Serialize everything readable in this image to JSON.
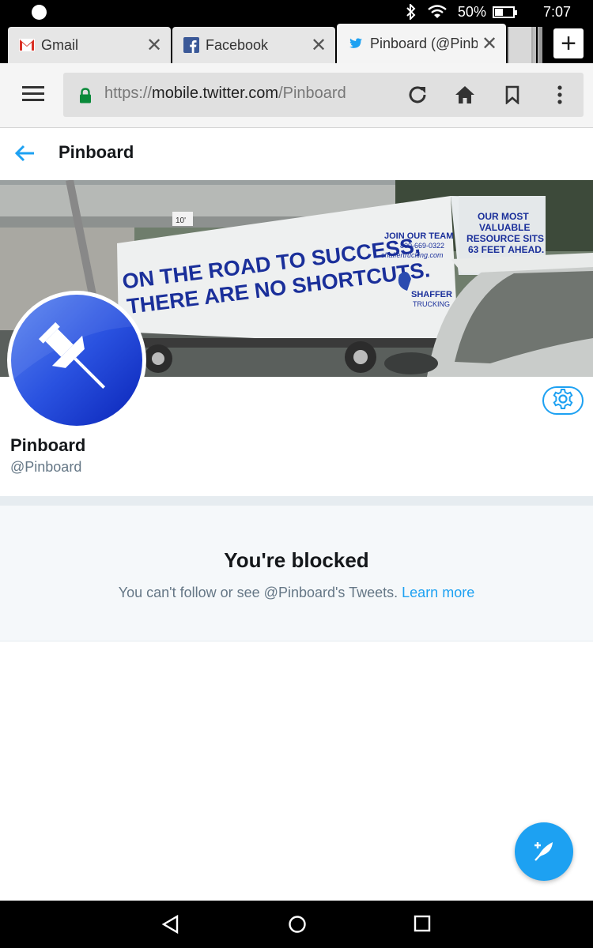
{
  "status_bar": {
    "battery_percent_label": "50%",
    "battery_level": 0.5,
    "time": "7:07",
    "icons": [
      "bluetooth-icon",
      "wifi-icon",
      "battery-icon"
    ]
  },
  "tabs": [
    {
      "title": "Gmail",
      "favicon": "gmail-icon",
      "active": false
    },
    {
      "title": "Facebook",
      "favicon": "facebook-icon",
      "active": false
    },
    {
      "title": "Pinboard (@Pinbo",
      "favicon": "twitter-icon",
      "active": true
    }
  ],
  "new_tab_label": "+",
  "address_bar": {
    "url_prefix": "https://",
    "url_domain": "mobile.twitter.com",
    "url_path": "/Pinboard"
  },
  "header": {
    "title": "Pinboard"
  },
  "banner": {
    "sign_line1": "ON THE ROAD TO SUCCESS,",
    "sign_line2": "THERE ARE NO SHORTCUTS.",
    "join_team": "JOIN OUR TEAM",
    "phone": "800-669-0322",
    "website": "shaffertrucking.com",
    "brand": "SHAFFER",
    "brand_sub": "TRUCKING",
    "corner_line1": "OUR MOST",
    "corner_line2": "VALUABLE",
    "corner_line3": "RESOURCE SITS",
    "corner_line4": "63 FEET AHEAD.",
    "bridge_sign": "10'"
  },
  "profile": {
    "name": "Pinboard",
    "handle": "@Pinboard"
  },
  "blocked": {
    "title": "You're blocked",
    "message": "You can't follow or see @Pinboard's Tweets.",
    "link": "Learn more"
  },
  "colors": {
    "twitter_blue": "#1da1f2",
    "avatar_blue": "#1a3fd6",
    "text_dark": "#14171a",
    "text_gray": "#657786",
    "lock_green": "#0a8a3a"
  }
}
